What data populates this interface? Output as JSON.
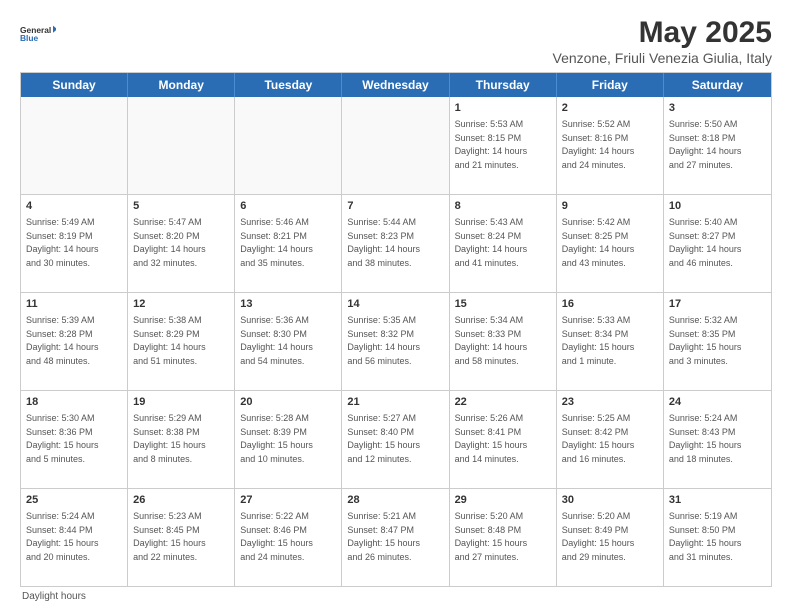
{
  "logo": {
    "general": "General",
    "blue": "Blue"
  },
  "title": "May 2025",
  "subtitle": "Venzone, Friuli Venezia Giulia, Italy",
  "days_of_week": [
    "Sunday",
    "Monday",
    "Tuesday",
    "Wednesday",
    "Thursday",
    "Friday",
    "Saturday"
  ],
  "weeks": [
    [
      {
        "day": "",
        "info": ""
      },
      {
        "day": "",
        "info": ""
      },
      {
        "day": "",
        "info": ""
      },
      {
        "day": "",
        "info": ""
      },
      {
        "day": "1",
        "info": "Sunrise: 5:53 AM\nSunset: 8:15 PM\nDaylight: 14 hours\nand 21 minutes."
      },
      {
        "day": "2",
        "info": "Sunrise: 5:52 AM\nSunset: 8:16 PM\nDaylight: 14 hours\nand 24 minutes."
      },
      {
        "day": "3",
        "info": "Sunrise: 5:50 AM\nSunset: 8:18 PM\nDaylight: 14 hours\nand 27 minutes."
      }
    ],
    [
      {
        "day": "4",
        "info": "Sunrise: 5:49 AM\nSunset: 8:19 PM\nDaylight: 14 hours\nand 30 minutes."
      },
      {
        "day": "5",
        "info": "Sunrise: 5:47 AM\nSunset: 8:20 PM\nDaylight: 14 hours\nand 32 minutes."
      },
      {
        "day": "6",
        "info": "Sunrise: 5:46 AM\nSunset: 8:21 PM\nDaylight: 14 hours\nand 35 minutes."
      },
      {
        "day": "7",
        "info": "Sunrise: 5:44 AM\nSunset: 8:23 PM\nDaylight: 14 hours\nand 38 minutes."
      },
      {
        "day": "8",
        "info": "Sunrise: 5:43 AM\nSunset: 8:24 PM\nDaylight: 14 hours\nand 41 minutes."
      },
      {
        "day": "9",
        "info": "Sunrise: 5:42 AM\nSunset: 8:25 PM\nDaylight: 14 hours\nand 43 minutes."
      },
      {
        "day": "10",
        "info": "Sunrise: 5:40 AM\nSunset: 8:27 PM\nDaylight: 14 hours\nand 46 minutes."
      }
    ],
    [
      {
        "day": "11",
        "info": "Sunrise: 5:39 AM\nSunset: 8:28 PM\nDaylight: 14 hours\nand 48 minutes."
      },
      {
        "day": "12",
        "info": "Sunrise: 5:38 AM\nSunset: 8:29 PM\nDaylight: 14 hours\nand 51 minutes."
      },
      {
        "day": "13",
        "info": "Sunrise: 5:36 AM\nSunset: 8:30 PM\nDaylight: 14 hours\nand 54 minutes."
      },
      {
        "day": "14",
        "info": "Sunrise: 5:35 AM\nSunset: 8:32 PM\nDaylight: 14 hours\nand 56 minutes."
      },
      {
        "day": "15",
        "info": "Sunrise: 5:34 AM\nSunset: 8:33 PM\nDaylight: 14 hours\nand 58 minutes."
      },
      {
        "day": "16",
        "info": "Sunrise: 5:33 AM\nSunset: 8:34 PM\nDaylight: 15 hours\nand 1 minute."
      },
      {
        "day": "17",
        "info": "Sunrise: 5:32 AM\nSunset: 8:35 PM\nDaylight: 15 hours\nand 3 minutes."
      }
    ],
    [
      {
        "day": "18",
        "info": "Sunrise: 5:30 AM\nSunset: 8:36 PM\nDaylight: 15 hours\nand 5 minutes."
      },
      {
        "day": "19",
        "info": "Sunrise: 5:29 AM\nSunset: 8:38 PM\nDaylight: 15 hours\nand 8 minutes."
      },
      {
        "day": "20",
        "info": "Sunrise: 5:28 AM\nSunset: 8:39 PM\nDaylight: 15 hours\nand 10 minutes."
      },
      {
        "day": "21",
        "info": "Sunrise: 5:27 AM\nSunset: 8:40 PM\nDaylight: 15 hours\nand 12 minutes."
      },
      {
        "day": "22",
        "info": "Sunrise: 5:26 AM\nSunset: 8:41 PM\nDaylight: 15 hours\nand 14 minutes."
      },
      {
        "day": "23",
        "info": "Sunrise: 5:25 AM\nSunset: 8:42 PM\nDaylight: 15 hours\nand 16 minutes."
      },
      {
        "day": "24",
        "info": "Sunrise: 5:24 AM\nSunset: 8:43 PM\nDaylight: 15 hours\nand 18 minutes."
      }
    ],
    [
      {
        "day": "25",
        "info": "Sunrise: 5:24 AM\nSunset: 8:44 PM\nDaylight: 15 hours\nand 20 minutes."
      },
      {
        "day": "26",
        "info": "Sunrise: 5:23 AM\nSunset: 8:45 PM\nDaylight: 15 hours\nand 22 minutes."
      },
      {
        "day": "27",
        "info": "Sunrise: 5:22 AM\nSunset: 8:46 PM\nDaylight: 15 hours\nand 24 minutes."
      },
      {
        "day": "28",
        "info": "Sunrise: 5:21 AM\nSunset: 8:47 PM\nDaylight: 15 hours\nand 26 minutes."
      },
      {
        "day": "29",
        "info": "Sunrise: 5:20 AM\nSunset: 8:48 PM\nDaylight: 15 hours\nand 27 minutes."
      },
      {
        "day": "30",
        "info": "Sunrise: 5:20 AM\nSunset: 8:49 PM\nDaylight: 15 hours\nand 29 minutes."
      },
      {
        "day": "31",
        "info": "Sunrise: 5:19 AM\nSunset: 8:50 PM\nDaylight: 15 hours\nand 31 minutes."
      }
    ]
  ],
  "footer": "Daylight hours"
}
